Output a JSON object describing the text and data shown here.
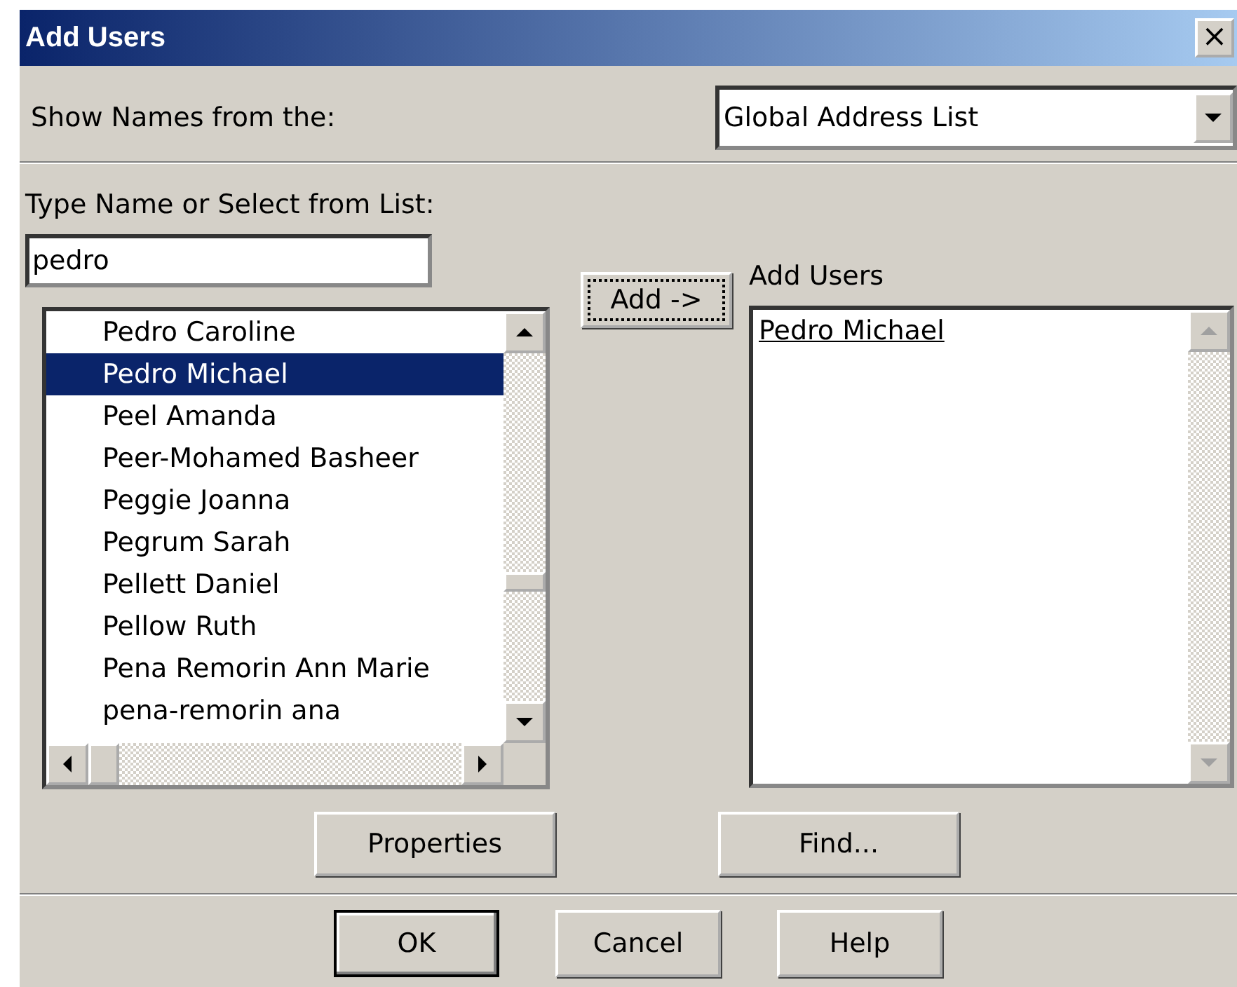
{
  "window": {
    "title": "Add Users",
    "close": "×"
  },
  "source": {
    "label": "Show Names from the:",
    "value": "Global Address List"
  },
  "search": {
    "label": "Type Name or Select from List:",
    "value": "pedro"
  },
  "directory": {
    "items": [
      {
        "name": "Pedro Caroline",
        "selected": false
      },
      {
        "name": "Pedro Michael",
        "selected": true
      },
      {
        "name": "Peel Amanda",
        "selected": false
      },
      {
        "name": "Peer-Mohamed Basheer",
        "selected": false
      },
      {
        "name": "Peggie Joanna",
        "selected": false
      },
      {
        "name": "Pegrum Sarah",
        "selected": false
      },
      {
        "name": "Pellett Daniel",
        "selected": false
      },
      {
        "name": "Pellow Ruth",
        "selected": false
      },
      {
        "name": "Pena Remorin Ann Marie",
        "selected": false
      },
      {
        "name": "pena-remorin ana",
        "selected": false
      }
    ]
  },
  "add_button": {
    "label": "Add ->",
    "focused": true
  },
  "added": {
    "label": "Add Users",
    "items": [
      "Pedro Michael"
    ],
    "enabled_scroll": false
  },
  "actions": [
    {
      "label": "Properties"
    },
    {
      "label": "Find..."
    }
  ],
  "buttons": [
    {
      "label": "OK",
      "default": true
    },
    {
      "label": "Cancel",
      "default": false
    },
    {
      "label": "Help",
      "default": false
    }
  ]
}
